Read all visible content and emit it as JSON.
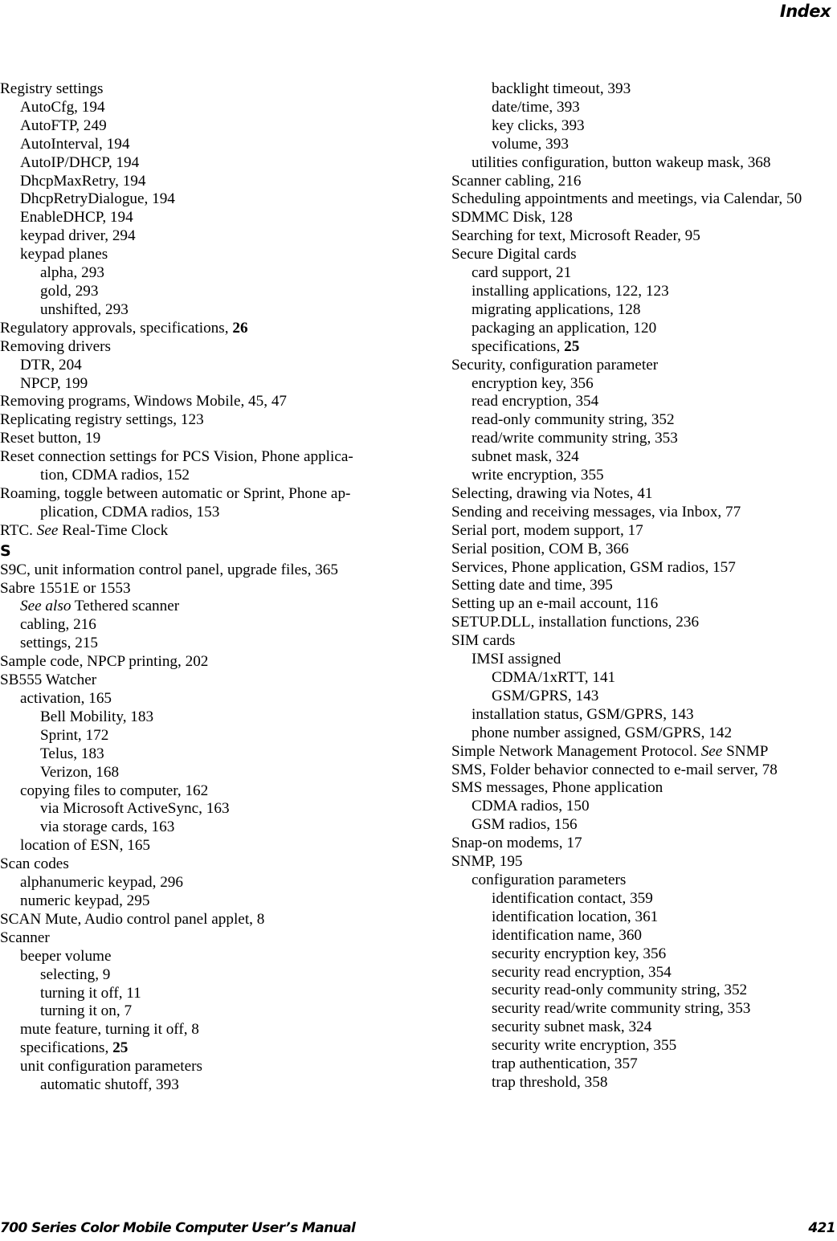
{
  "header": {
    "title": "Index"
  },
  "footer": {
    "manual_title": "700 Series Color Mobile Computer User’s Manual",
    "page_number": "421"
  },
  "left_column": [
    {
      "level": 0,
      "text": "Registry settings"
    },
    {
      "level": 1,
      "text": "AutoCfg, 194"
    },
    {
      "level": 1,
      "text": "AutoFTP, 249"
    },
    {
      "level": 1,
      "text": "AutoInterval, 194"
    },
    {
      "level": 1,
      "text": "AutoIP/DHCP, 194"
    },
    {
      "level": 1,
      "text": "DhcpMaxRetry, 194"
    },
    {
      "level": 1,
      "text": "DhcpRetryDialogue, 194"
    },
    {
      "level": 1,
      "text": "EnableDHCP, 194"
    },
    {
      "level": 1,
      "text": "keypad driver, 294"
    },
    {
      "level": 1,
      "text": "keypad planes"
    },
    {
      "level": 2,
      "text": "alpha, 293"
    },
    {
      "level": 2,
      "text": "gold, 293"
    },
    {
      "level": 2,
      "text": "unshifted, 293"
    },
    {
      "level": 0,
      "text": "Regulatory approvals, specifications, ",
      "bold_suffix": "26"
    },
    {
      "level": 0,
      "text": "Removing drivers"
    },
    {
      "level": 1,
      "text": "DTR, 204"
    },
    {
      "level": 1,
      "text": "NPCP, 199"
    },
    {
      "level": 0,
      "text": "Removing programs, Windows Mobile, 45, 47"
    },
    {
      "level": 0,
      "text": "Replicating registry settings, 123"
    },
    {
      "level": 0,
      "text": "Reset button, 19"
    },
    {
      "level": 0,
      "wrap": true,
      "text": "Reset connection settings for PCS Vision, Phone applica-tion, CDMA radios, 152",
      "line1": "Reset connection settings for PCS Vision, Phone applica-",
      "line2": "tion, CDMA radios, 152"
    },
    {
      "level": 0,
      "wrap": true,
      "text": "Roaming, toggle between automatic or Sprint, Phone ap-plication, CDMA radios, 153",
      "line1": "Roaming, toggle between automatic or Sprint, Phone ap-",
      "line2": "plication, CDMA radios, 153"
    },
    {
      "level": 0,
      "text": "RTC. ",
      "italic_part": "See",
      "after_italic": " Real-Time Clock"
    },
    {
      "section": "S"
    },
    {
      "level": 0,
      "text": "S9C, unit information control panel, upgrade files, 365"
    },
    {
      "level": 0,
      "text": "Sabre 1551E or 1553"
    },
    {
      "level": 1,
      "text": "",
      "italic_part": "See also",
      "after_italic": " Tethered scanner"
    },
    {
      "level": 1,
      "text": "cabling, 216"
    },
    {
      "level": 1,
      "text": "settings, 215"
    },
    {
      "level": 0,
      "text": "Sample code, NPCP printing, 202"
    },
    {
      "level": 0,
      "text": "SB555 Watcher"
    },
    {
      "level": 1,
      "text": "activation, 165"
    },
    {
      "level": 2,
      "text": "Bell Mobility, 183"
    },
    {
      "level": 2,
      "text": "Sprint, 172"
    },
    {
      "level": 2,
      "text": "Telus, 183"
    },
    {
      "level": 2,
      "text": "Verizon, 168"
    },
    {
      "level": 1,
      "text": "copying files to computer, 162"
    },
    {
      "level": 2,
      "text": "via Microsoft ActiveSync, 163"
    },
    {
      "level": 2,
      "text": "via storage cards, 163"
    },
    {
      "level": 1,
      "text": "location of ESN, 165"
    },
    {
      "level": 0,
      "text": "Scan codes"
    },
    {
      "level": 1,
      "text": "alphanumeric keypad, 296"
    },
    {
      "level": 1,
      "text": "numeric keypad, 295"
    },
    {
      "level": 0,
      "text": "SCAN Mute, Audio control panel applet, 8"
    },
    {
      "level": 0,
      "text": "Scanner"
    },
    {
      "level": 1,
      "text": "beeper volume"
    },
    {
      "level": 2,
      "text": "selecting, 9"
    },
    {
      "level": 2,
      "text": "turning it off, 11"
    },
    {
      "level": 2,
      "text": "turning it on, 7"
    },
    {
      "level": 1,
      "text": "mute feature, turning it off, 8"
    },
    {
      "level": 1,
      "text": "specifications, ",
      "bold_suffix": "25"
    },
    {
      "level": 1,
      "text": "unit configuration parameters"
    },
    {
      "level": 2,
      "text": "automatic shutoff, 393"
    }
  ],
  "right_column": [
    {
      "level": 2,
      "text": "backlight timeout, 393"
    },
    {
      "level": 2,
      "text": "date/time, 393"
    },
    {
      "level": 2,
      "text": "key clicks, 393"
    },
    {
      "level": 2,
      "text": "volume, 393"
    },
    {
      "level": 1,
      "text": "utilities configuration, button wakeup mask, 368"
    },
    {
      "level": 0,
      "text": "Scanner cabling, 216"
    },
    {
      "level": 0,
      "text": "Scheduling appointments and meetings, via Calendar, 50"
    },
    {
      "level": 0,
      "text": "SDMMC Disk, 128"
    },
    {
      "level": 0,
      "text": "Searching for text, Microsoft Reader, 95"
    },
    {
      "level": 0,
      "text": "Secure Digital cards"
    },
    {
      "level": 1,
      "text": "card support, 21"
    },
    {
      "level": 1,
      "text": "installing applications, 122, 123"
    },
    {
      "level": 1,
      "text": "migrating applications, 128"
    },
    {
      "level": 1,
      "text": "packaging an application, 120"
    },
    {
      "level": 1,
      "text": "specifications, ",
      "bold_suffix": "25"
    },
    {
      "level": 0,
      "text": "Security, configuration parameter"
    },
    {
      "level": 1,
      "text": "encryption key, 356"
    },
    {
      "level": 1,
      "text": "read encryption, 354"
    },
    {
      "level": 1,
      "text": "read-only community string, 352"
    },
    {
      "level": 1,
      "text": "read/write community string, 353"
    },
    {
      "level": 1,
      "text": "subnet mask, 324"
    },
    {
      "level": 1,
      "text": "write encryption, 355"
    },
    {
      "level": 0,
      "text": "Selecting, drawing via Notes, 41"
    },
    {
      "level": 0,
      "text": "Sending and receiving messages, via Inbox, 77"
    },
    {
      "level": 0,
      "text": "Serial port, modem support, 17"
    },
    {
      "level": 0,
      "text": "Serial position, COM B, 366"
    },
    {
      "level": 0,
      "text": "Services, Phone application, GSM radios, 157"
    },
    {
      "level": 0,
      "text": "Setting date and time, 395"
    },
    {
      "level": 0,
      "text": "Setting up an e-mail account, 116"
    },
    {
      "level": 0,
      "text": "SETUP.DLL, installation functions, 236"
    },
    {
      "level": 0,
      "text": "SIM cards"
    },
    {
      "level": 1,
      "text": "IMSI assigned"
    },
    {
      "level": 2,
      "text": "CDMA/1xRTT, 141"
    },
    {
      "level": 2,
      "text": "GSM/GPRS, 143"
    },
    {
      "level": 1,
      "text": "installation status, GSM/GPRS, 143"
    },
    {
      "level": 1,
      "text": "phone number assigned, GSM/GPRS, 142"
    },
    {
      "level": 0,
      "text": "Simple Network Management Protocol. ",
      "italic_part": "See",
      "after_italic": " SNMP"
    },
    {
      "level": 0,
      "text": "SMS, Folder behavior connected to e-mail server, 78"
    },
    {
      "level": 0,
      "text": "SMS messages, Phone application"
    },
    {
      "level": 1,
      "text": "CDMA radios, 150"
    },
    {
      "level": 1,
      "text": "GSM radios, 156"
    },
    {
      "level": 0,
      "text": "Snap-on modems, 17"
    },
    {
      "level": 0,
      "text": "SNMP, 195"
    },
    {
      "level": 1,
      "text": "configuration parameters"
    },
    {
      "level": 2,
      "text": "identification contact, 359"
    },
    {
      "level": 2,
      "text": "identification location, 361"
    },
    {
      "level": 2,
      "text": "identification name, 360"
    },
    {
      "level": 2,
      "text": "security encryption key, 356"
    },
    {
      "level": 2,
      "text": "security read encryption, 354"
    },
    {
      "level": 2,
      "text": "security read-only community string, 352"
    },
    {
      "level": 2,
      "text": "security read/write community string, 353"
    },
    {
      "level": 2,
      "text": "security subnet mask, 324"
    },
    {
      "level": 2,
      "text": "security write encryption, 355"
    },
    {
      "level": 2,
      "text": "trap authentication, 357"
    },
    {
      "level": 2,
      "text": "trap threshold, 358"
    }
  ]
}
